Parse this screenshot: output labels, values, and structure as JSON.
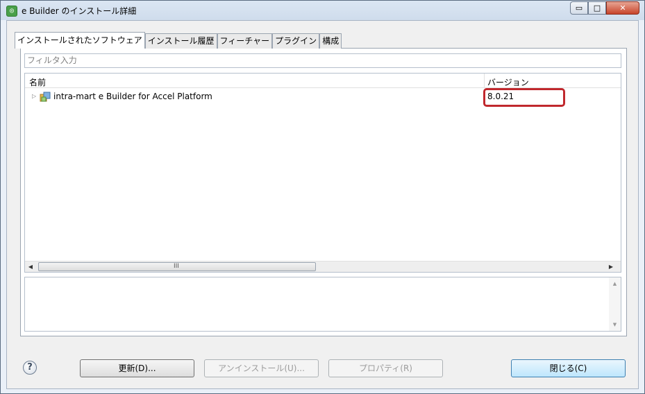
{
  "window": {
    "title": "e Builder のインストール詳細",
    "controls": {
      "minimize": "▭",
      "maximize": "□",
      "close": "✕"
    }
  },
  "tabs": [
    {
      "label": "インストールされたソフトウェア",
      "active": true
    },
    {
      "label": "インストール履歴",
      "active": false
    },
    {
      "label": "フィーチャー",
      "active": false
    },
    {
      "label": "プラグイン",
      "active": false
    },
    {
      "label": "構成",
      "active": false
    }
  ],
  "filter": {
    "placeholder": "フィルタ入力",
    "value": ""
  },
  "table": {
    "columns": {
      "name": "名前",
      "version": "バージョン"
    },
    "rows": [
      {
        "name": "intra-mart e Builder for Accel Platform",
        "version": "8.0.21",
        "expanded": false
      }
    ]
  },
  "scrollbar": {
    "grip": "III"
  },
  "buttons": {
    "update": "更新(D)...",
    "uninstall": "アンインストール(U)...",
    "properties": "プロパティ(R)",
    "close": "閉じる(C)"
  },
  "help": {
    "glyph": "?"
  },
  "colors": {
    "highlight": "#c0282d",
    "primary_button": "#bee6fd"
  }
}
